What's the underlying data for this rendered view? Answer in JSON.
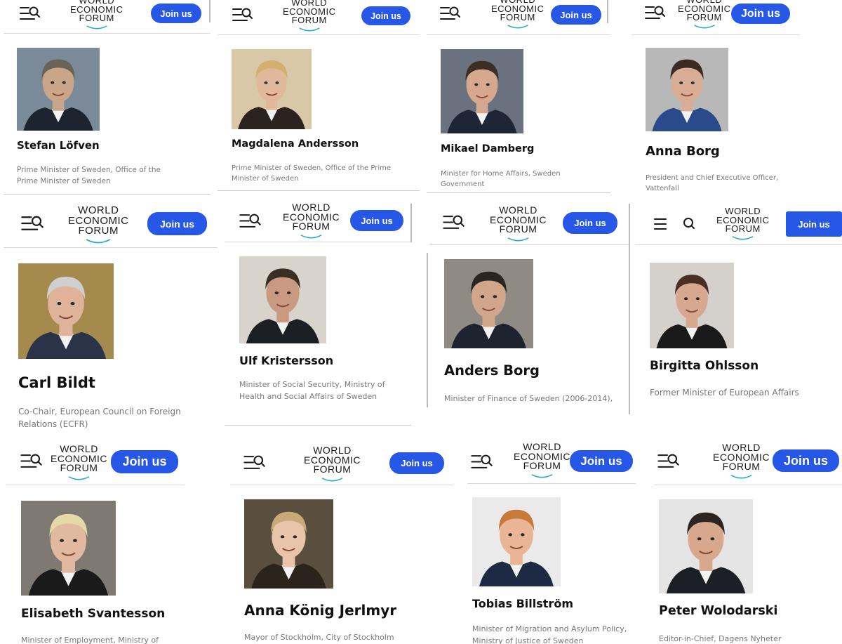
{
  "brand": {
    "logo_lines": [
      "WORLD",
      "ECONOMIC",
      "FORUM"
    ],
    "join_label": "Join us",
    "accent_color": "#2757e6"
  },
  "icons": [
    "menu-icon",
    "search-icon"
  ],
  "profiles": [
    {
      "name": "Stefan Löfven",
      "role": "Prime Minister of Sweden, Office of the Prime Minister of Sweden"
    },
    {
      "name": "Magdalena Andersson",
      "role": "Prime Minister of Sweden, Office of the Prime Minister of Sweden"
    },
    {
      "name": "Mikael Damberg",
      "role": "Minister for Home Affairs, Sweden Government"
    },
    {
      "name": "Anna Borg",
      "role": "President and Chief Executive Officer, Vattenfall"
    },
    {
      "name": "Carl Bildt",
      "role": "Co-Chair, European Council on Foreign Relations (ECFR)"
    },
    {
      "name": "Ulf Kristersson",
      "role": "Minister of Social Security, Ministry of Health and Social Affairs of Sweden"
    },
    {
      "name": "Anders Borg",
      "role": "Minister of Finance of Sweden (2006-2014),"
    },
    {
      "name": "Birgitta Ohlsson",
      "role": "Former Minister of European Affairs"
    },
    {
      "name": "Elisabeth Svantesson",
      "role": "Minister of Employment, Ministry of"
    },
    {
      "name": "Anna König Jerlmyr",
      "role": "Mayor of Stockholm, City of Stockholm"
    },
    {
      "name": "Tobias Billström",
      "role": "Minister of Migration and Asylum Policy, Ministry of Justice of Sweden"
    },
    {
      "name": "Peter Wolodarski",
      "role": "Editor-in-Chief, Dagens Nyheter"
    }
  ]
}
